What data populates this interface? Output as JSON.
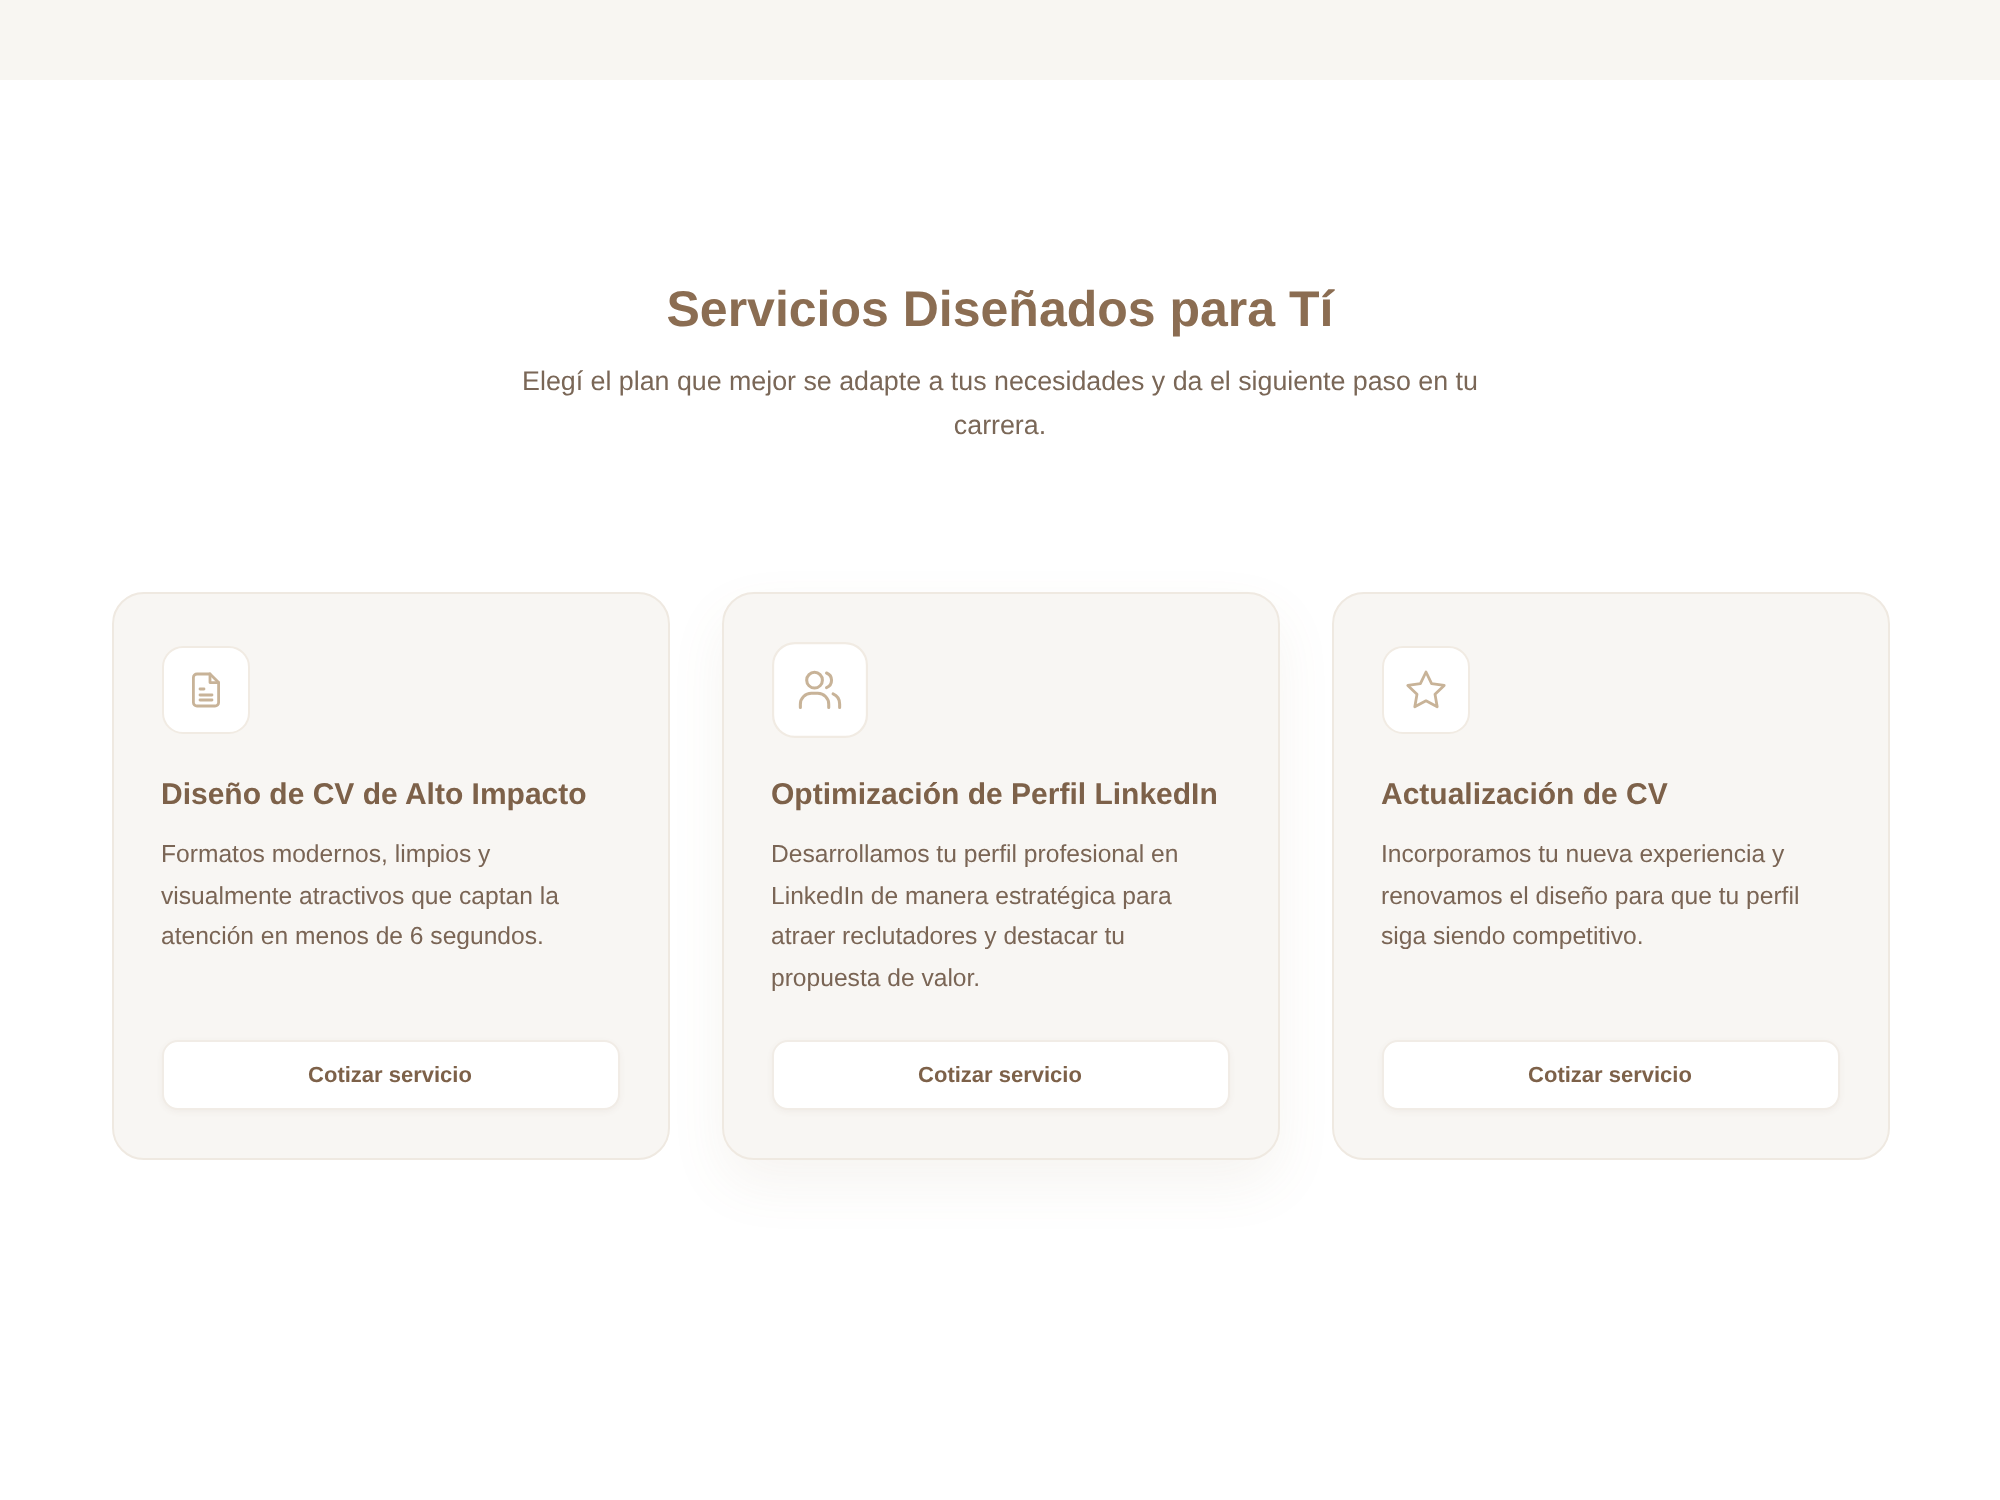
{
  "section": {
    "title": "Servicios Diseñados para Tí",
    "subtitle": "Elegí el plan que mejor se adapte a tus necesidades y da el siguiente paso en tu carrera."
  },
  "services": [
    {
      "title": "Diseño de CV de Alto Impacto",
      "description": "Formatos modernos, limpios y visualmente atractivos que captan la atención en menos de 6 segundos.",
      "button": "Cotizar servicio",
      "hovered": false
    },
    {
      "title": "Optimización de Perfil LinkedIn",
      "description": "Desarrollamos tu perfil profesional en LinkedIn de manera estratégica para atraer reclutadores y destacar tu propuesta de valor.",
      "button": "Cotizar servicio",
      "hovered": true
    },
    {
      "title": "Actualización de CV",
      "description": "Incorporamos tu nueva experiencia y renovamos el diseño para que tu perfil siga siendo competitivo.",
      "button": "Cotizar servicio",
      "hovered": false
    }
  ]
}
